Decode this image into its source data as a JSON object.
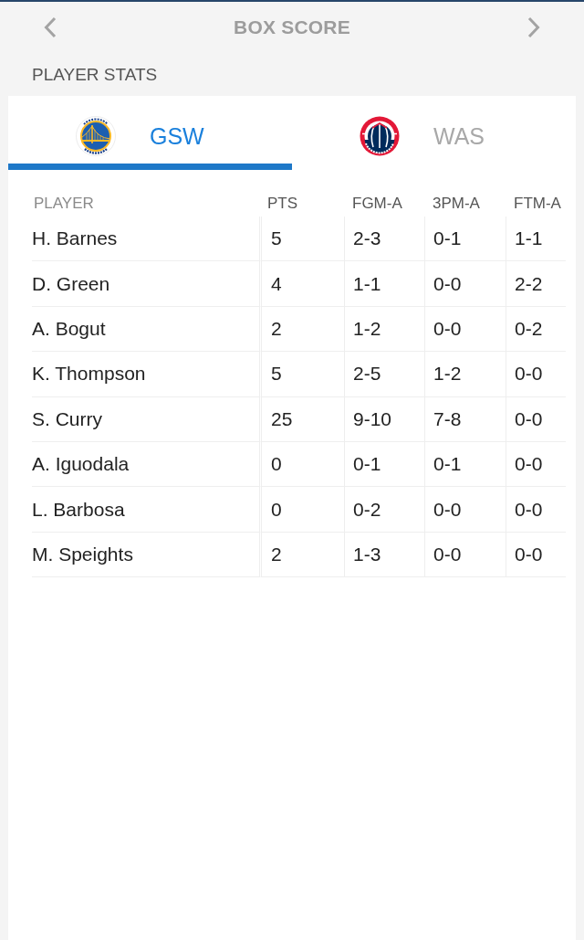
{
  "header": {
    "title": "BOX SCORE"
  },
  "section_title": "PLAYER STATS",
  "tabs": [
    {
      "label": "GSW",
      "selected": true,
      "kind": "bridge"
    },
    {
      "label": "WAS",
      "selected": false,
      "kind": "ball"
    }
  ],
  "table": {
    "columns": [
      "PLAYER",
      "PTS",
      "FGM-A",
      "3PM-A",
      "FTM-A"
    ],
    "rows": [
      {
        "cells": [
          "H. Barnes",
          "5",
          "2-3",
          "0-1",
          "1-1"
        ]
      },
      {
        "cells": [
          "D. Green",
          "4",
          "1-1",
          "0-0",
          "2-2"
        ]
      },
      {
        "cells": [
          "A. Bogut",
          "2",
          "1-2",
          "0-0",
          "0-2"
        ]
      },
      {
        "cells": [
          "K. Thompson",
          "5",
          "2-5",
          "1-2",
          "0-0"
        ]
      },
      {
        "cells": [
          "S. Curry",
          "25",
          "9-10",
          "7-8",
          "0-0"
        ]
      },
      {
        "cells": [
          "A. Iguodala",
          "0",
          "0-1",
          "0-1",
          "0-0"
        ]
      },
      {
        "cells": [
          "L. Barbosa",
          "0",
          "0-2",
          "0-0",
          "0-0"
        ]
      },
      {
        "cells": [
          "M. Speights",
          "2",
          "1-3",
          "0-0",
          "0-0"
        ]
      }
    ]
  }
}
